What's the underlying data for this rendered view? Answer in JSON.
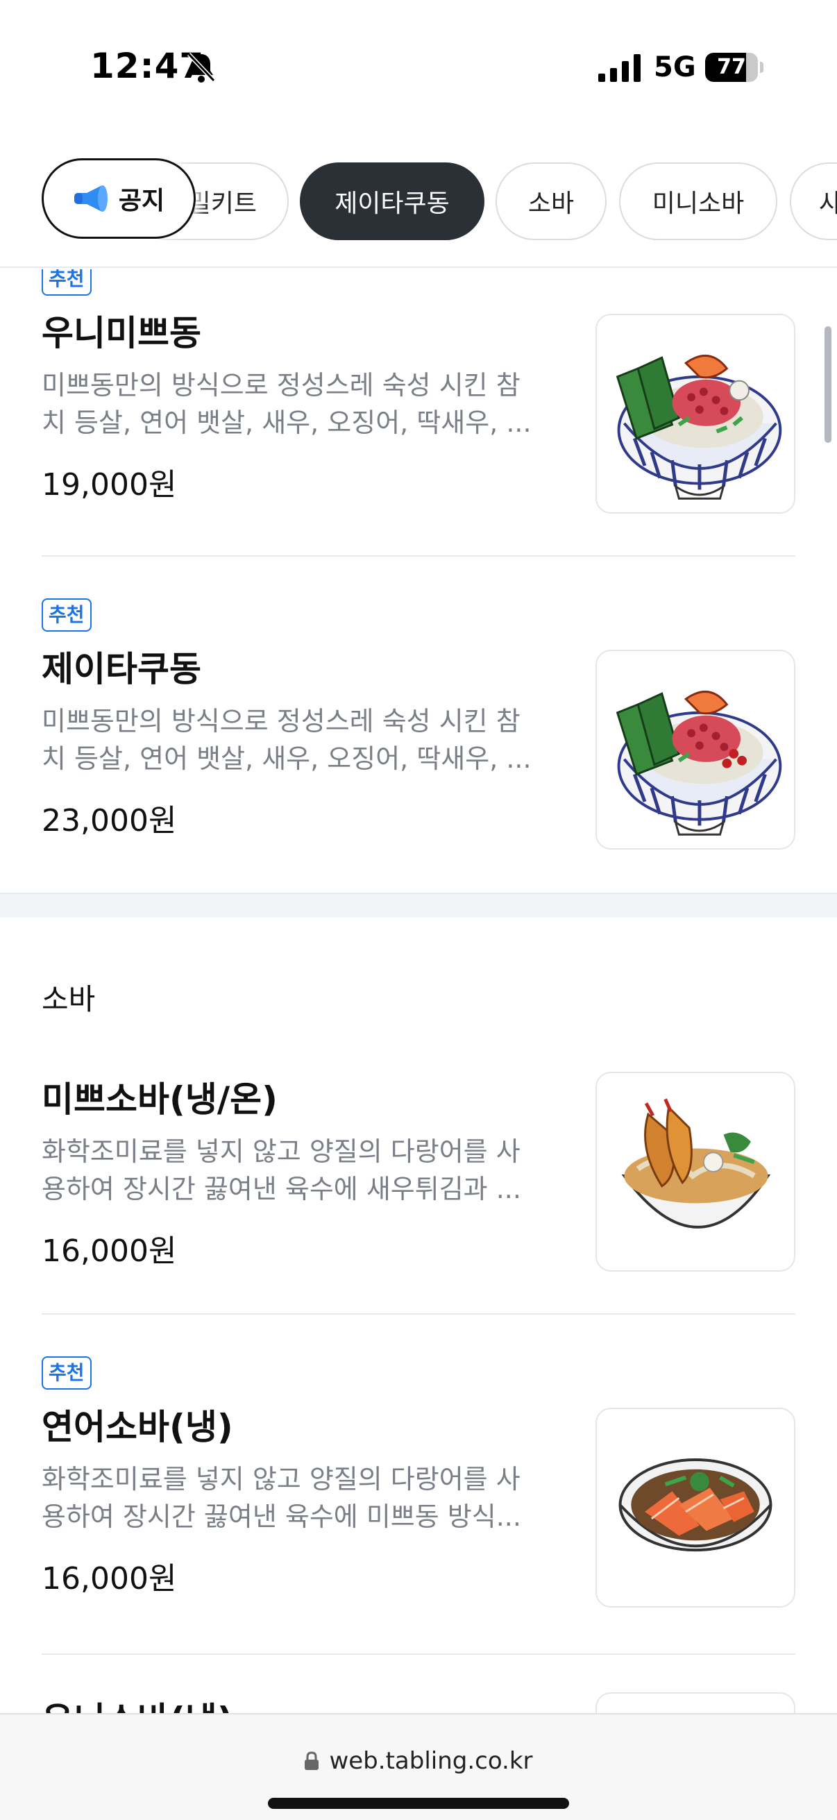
{
  "status_bar": {
    "time": "12:47",
    "network": "5G",
    "battery_percent": "77",
    "battery_level": 0.77,
    "icons": [
      "bell-off-icon",
      "signal-icon",
      "battery-icon"
    ]
  },
  "notice_button": {
    "label": "공지",
    "icon": "megaphone-icon"
  },
  "tabs": [
    {
      "label": "밀키트",
      "active": false
    },
    {
      "label": "제이타쿠동",
      "active": true
    },
    {
      "label": "소바",
      "active": false
    },
    {
      "label": "미니소바",
      "active": false
    },
    {
      "label": "샤",
      "active": false
    }
  ],
  "menu": {
    "badge_label": "추천",
    "items": [
      {
        "recommended": true,
        "name": "우니미쁘동",
        "desc_line1": "미쁘동만의 방식으로 정성스레 숙성 시킨 참",
        "desc_line2": "치 등살, 연어 뱃살, 새우, 오징어, 딱새우, ...",
        "price": "19,000원",
        "image": "donburi-bowl"
      },
      {
        "recommended": true,
        "name": "제이타쿠동",
        "desc_line1": "미쁘동만의 방식으로 정성스레 숙성 시킨 참",
        "desc_line2": "치 등살, 연어 뱃살, 새우, 오징어, 딱새우, ...",
        "price": "23,000원",
        "image": "donburi-bowl"
      }
    ],
    "soba_section": {
      "title": "소바",
      "items": [
        {
          "recommended": false,
          "name": "미쁘소바(냉/온)",
          "desc_line1": "화학조미료를 넣지 않고 양질의 다랑어를 사",
          "desc_line2": "용하여 장시간 끓여낸 육수에 새우튀김과 ...",
          "price": "16,000원",
          "image": "soba-tempura"
        },
        {
          "recommended": true,
          "name": "연어소바(냉)",
          "desc_line1": "화학조미료를 넣지 않고 양질의 다랑어를 사",
          "desc_line2": "용하여 장시간 끓여낸 육수에 미쁘동 방식...",
          "price": "16,000원",
          "image": "soba-salmon"
        },
        {
          "recommended": false,
          "name": "우니소바(냉)",
          "image": "soba"
        }
      ]
    }
  },
  "browser": {
    "url": "web.tabling.co.kr"
  },
  "colors": {
    "accent_blue": "#1a73e8",
    "active_tab": "#2b2f36",
    "desc_gray": "#7a7f87",
    "divider": "#e6e9ee"
  }
}
